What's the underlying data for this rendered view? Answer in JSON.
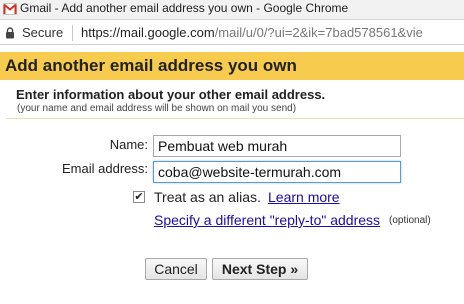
{
  "browser": {
    "window_title": "Gmail - Add another email address you own - Google Chrome",
    "secure_label": "Secure",
    "url_scheme": "https://",
    "url_host": "mail.google.com",
    "url_path": "/mail/u/0/?ui=2&ik=7bad578561&vie"
  },
  "dialog": {
    "title": "Add another email address you own",
    "intro_title": "Enter information about your other email address.",
    "intro_subtitle": "(your name and email address will be shown on mail you send)",
    "accent_color": "#f7cb4d"
  },
  "form": {
    "name_label": "Name:",
    "name_value": "Pembuat web murah",
    "email_label": "Email address:",
    "email_value": "coba@website-termurah.com",
    "alias_checked": true,
    "alias_check_glyph": "✔",
    "alias_label": "Treat as an alias.",
    "learn_more_label": "Learn more",
    "replyto_label": "Specify a different \"reply-to\" address",
    "optional_label": "(optional)"
  },
  "buttons": {
    "cancel_label": "Cancel",
    "next_label": "Next Step »"
  },
  "icons": {
    "tab_icon": "gmail-icon",
    "lock_icon": "lock-icon"
  }
}
